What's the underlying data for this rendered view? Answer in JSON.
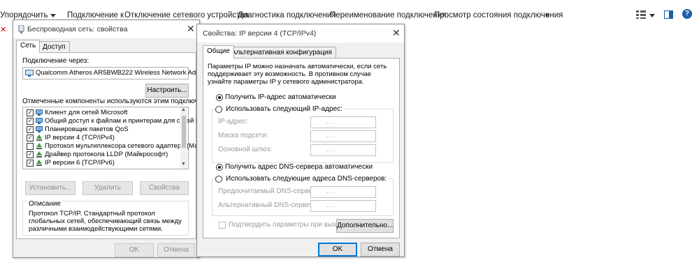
{
  "toolbar": {
    "items": [
      "Упорядочить",
      "Подключение к",
      "Отключение сетевого устройства",
      "Диагностика подключения",
      "Переименование подключения",
      "Просмотр состояния подключения"
    ],
    "more": "»",
    "help": "?"
  },
  "wireless_dialog": {
    "title": "Беспроводная сеть: свойства",
    "close": "✕",
    "tabs": [
      "Сеть",
      "Доступ"
    ],
    "connect_via_label": "Подключение через:",
    "adapter_name": "Qualcomm Atheros AR5BWB222 Wireless Network Adapt",
    "configure_button": "Настроить...",
    "components_label": "Отмеченные компоненты используются этим подключением:",
    "components": [
      {
        "label": "Клиент для сетей Microsoft",
        "checked": true,
        "icon": "network-client-icon"
      },
      {
        "label": "Общий доступ к файлам и принтерам для сетей M",
        "checked": true,
        "icon": "network-share-icon"
      },
      {
        "label": "Планировщик пакетов QoS",
        "checked": true,
        "icon": "network-service-icon"
      },
      {
        "label": "IP версии 4 (TCP/IPv4)",
        "checked": true,
        "icon": "protocol-icon"
      },
      {
        "label": "Протокол мультиплексора сетевого адаптера (Май",
        "checked": false,
        "icon": "protocol-icon"
      },
      {
        "label": "Драйвер протокола LLDP (Майкрософт)",
        "checked": true,
        "icon": "protocol-icon"
      },
      {
        "label": "IP версии 6 (TCP/IPv6)",
        "checked": true,
        "icon": "protocol-icon"
      }
    ],
    "install_button": "Установить...",
    "remove_button": "Удалить",
    "properties_button": "Свойства",
    "description_label": "Описание",
    "description_text": "Протокол TCP/IP. Стандартный протокол глобальных сетей, обеспечивающий связь между различными взаимодействующими сетями.",
    "ok_button": "OK",
    "cancel_button": "Отмена"
  },
  "ipv4_dialog": {
    "title": "Свойства: IP версии 4 (TCP/IPv4)",
    "close": "✕",
    "tabs": [
      "Общие",
      "Альтернативная конфигурация"
    ],
    "intro_text": "Параметры IP можно назначать автоматически, если сеть поддерживает эту возможность. В противном случае узнайте параметры IP у сетевого администратора.",
    "ip_auto": "Получить IP-адрес автоматически",
    "ip_manual": "Использовать следующий IP-адрес:",
    "ip_address_label": "IP-адрес:",
    "subnet_label": "Маска подсети:",
    "gateway_label": "Основной шлюз:",
    "dns_auto": "Получить адрес DNS-сервера автоматически",
    "dns_manual": "Использовать следующие адреса DNS-серверов:",
    "preferred_dns_label": "Предпочитаемый DNS-сервер:",
    "alternate_dns_label": "Альтернативный DNS-сервер:",
    "ip_placeholder": ".        .        .",
    "validate_label": "Подтвердить параметры при выходе",
    "advanced_button": "Дополнительно...",
    "ok_button": "OK",
    "cancel_button": "Отмена",
    "ip_mode": "auto",
    "dns_mode": "auto"
  }
}
